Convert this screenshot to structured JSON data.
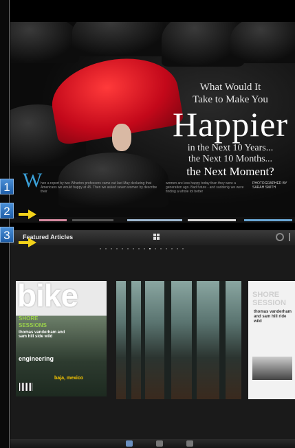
{
  "annotations": {
    "badges": [
      "1",
      "2",
      "3"
    ]
  },
  "magazine_page": {
    "headline": {
      "line1": "What Would It",
      "line2": "Take to Make You",
      "big": "Happier",
      "line3": "in the Next 10 Years...",
      "line4": "the Next 10 Months...",
      "line5": "the Next Moment?"
    },
    "dropcap": "W",
    "body_left": "hen a report by two Wharton professors came out last May declaring that Americans we would happy at 45. Then we asked seven women by describe their",
    "body_right": "women are less happy today than they were a generation ago. Bad future - and suddenly we were finding a whole lot better",
    "credit": "PHOTOGRAPHED BY SARAH SMITH"
  },
  "app": {
    "title": "Featured Articles",
    "page_dots": 16,
    "active_dot": 9,
    "cover": {
      "title": "bike",
      "blurb1": "SHORE",
      "blurb2": "SESSIONS",
      "blurb3": "thomas vanderham and sam hill side wild",
      "eng": "engineering",
      "mexico": "baja, mexico"
    },
    "side_page": {
      "title": "SHORE SESSION",
      "name": "thomas vanderham and sam hill ride wild"
    }
  },
  "colors": {
    "badge": "#2a6fc0",
    "arrow": "#f2d21a",
    "umbrella": "#d80d1f",
    "accent": "#9ad14b"
  }
}
